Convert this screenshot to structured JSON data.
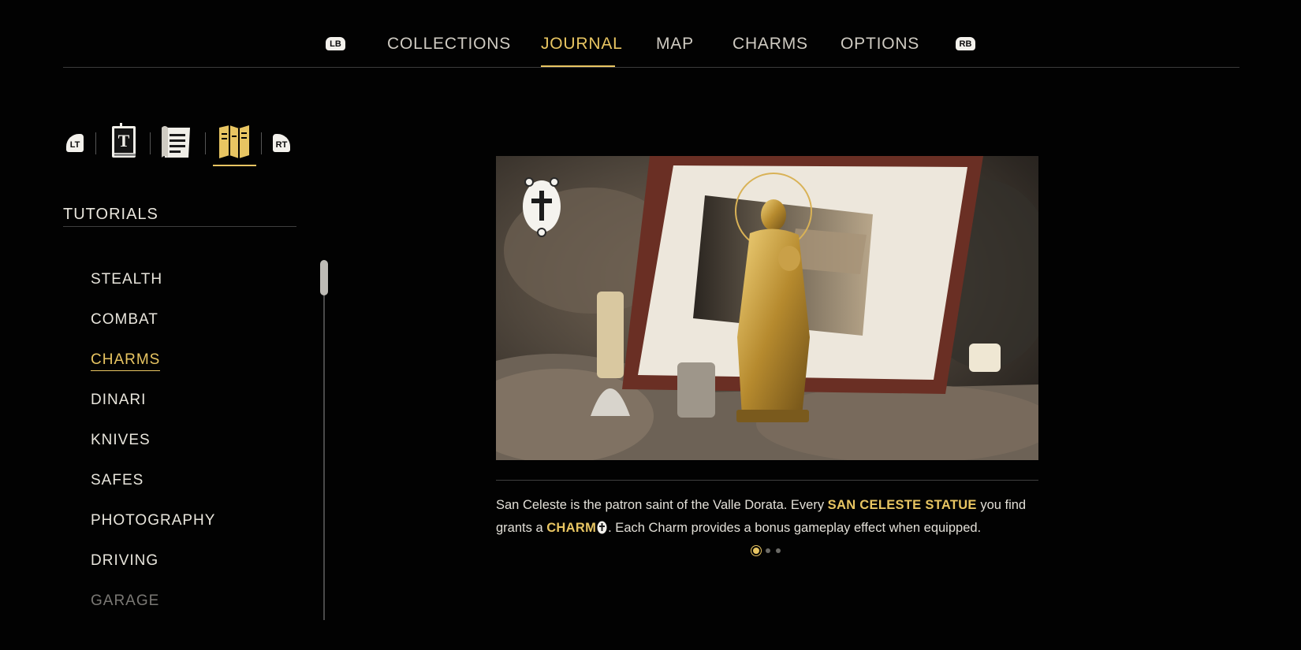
{
  "top_nav": {
    "left_bumper": "LB",
    "right_bumper": "RB",
    "tabs": [
      {
        "label": "COLLECTIONS"
      },
      {
        "label": "JOURNAL"
      },
      {
        "label": "MAP"
      },
      {
        "label": "CHARMS"
      },
      {
        "label": "OPTIONS"
      }
    ],
    "active_tab": "JOURNAL"
  },
  "sub_tabs": {
    "left_trigger": "LT",
    "right_trigger": "RT",
    "icons": [
      "book-icon",
      "document-icon",
      "tutorial-guide-icon"
    ],
    "active_icon": "tutorial-guide-icon"
  },
  "sidebar": {
    "section_title": "TUTORIALS",
    "items": [
      {
        "label": "STEALTH"
      },
      {
        "label": "COMBAT"
      },
      {
        "label": "CHARMS"
      },
      {
        "label": "DINARI"
      },
      {
        "label": "KNIVES"
      },
      {
        "label": "SAFES"
      },
      {
        "label": "PHOTOGRAPHY"
      },
      {
        "label": "DRIVING"
      },
      {
        "label": "GARAGE"
      }
    ],
    "active_item": "CHARMS"
  },
  "content": {
    "hero_icon": "cross-charm-icon",
    "description": {
      "p1": "San Celeste is the patron saint of the Valle Dorata. Every ",
      "highlight1": "SAN CELESTE STATUE",
      "p2": " you find grants a ",
      "highlight2": "CHARM",
      "p3": ". Each Charm provides a bonus gameplay effect when equipped."
    },
    "pagination": {
      "current": 1,
      "total": 3
    }
  },
  "colors": {
    "accent": "#e8c562",
    "background": "#020202",
    "text": "#e9e6dd"
  }
}
